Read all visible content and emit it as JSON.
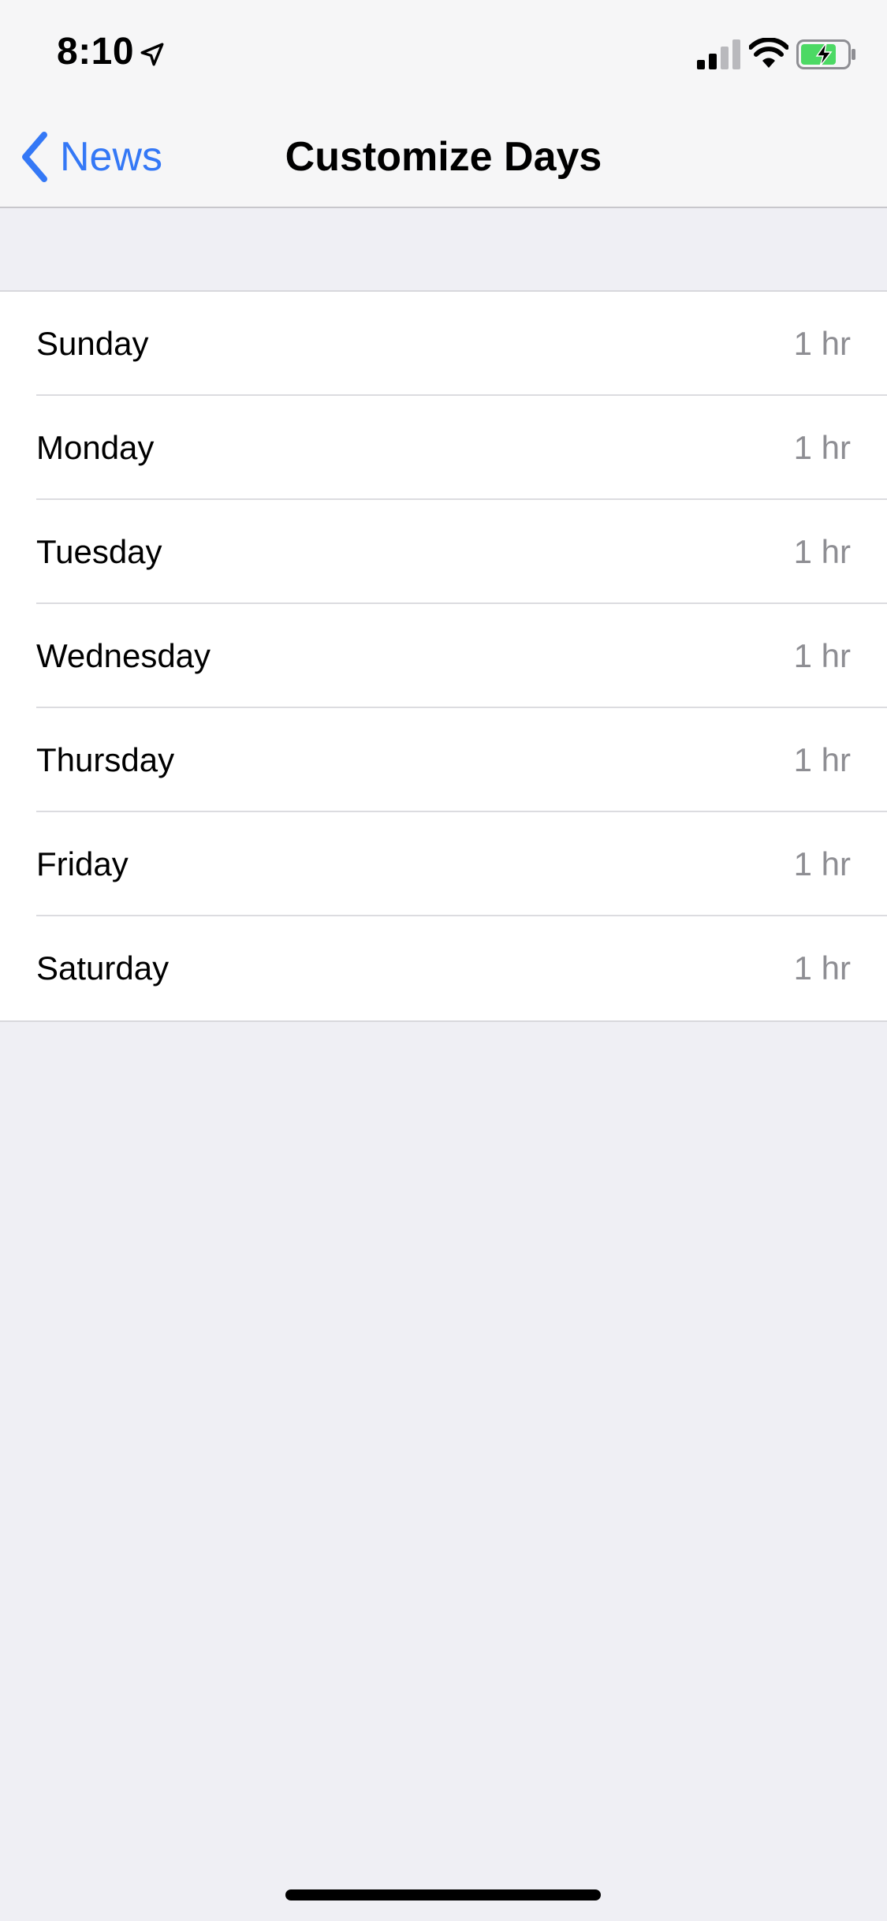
{
  "status_bar": {
    "time": "8:10",
    "icons": [
      "location-arrow-icon",
      "cellular-signal-icon",
      "wifi-icon",
      "battery-charging-icon"
    ]
  },
  "nav": {
    "back_label": "News",
    "title": "Customize Days"
  },
  "days": [
    {
      "label": "Sunday",
      "value": "1 hr"
    },
    {
      "label": "Monday",
      "value": "1 hr"
    },
    {
      "label": "Tuesday",
      "value": "1 hr"
    },
    {
      "label": "Wednesday",
      "value": "1 hr"
    },
    {
      "label": "Thursday",
      "value": "1 hr"
    },
    {
      "label": "Friday",
      "value": "1 hr"
    },
    {
      "label": "Saturday",
      "value": "1 hr"
    }
  ],
  "colors": {
    "accent": "#3478f6",
    "background": "#efeff4",
    "secondary_text": "#8e8e93",
    "battery_fill": "#4cd964"
  }
}
